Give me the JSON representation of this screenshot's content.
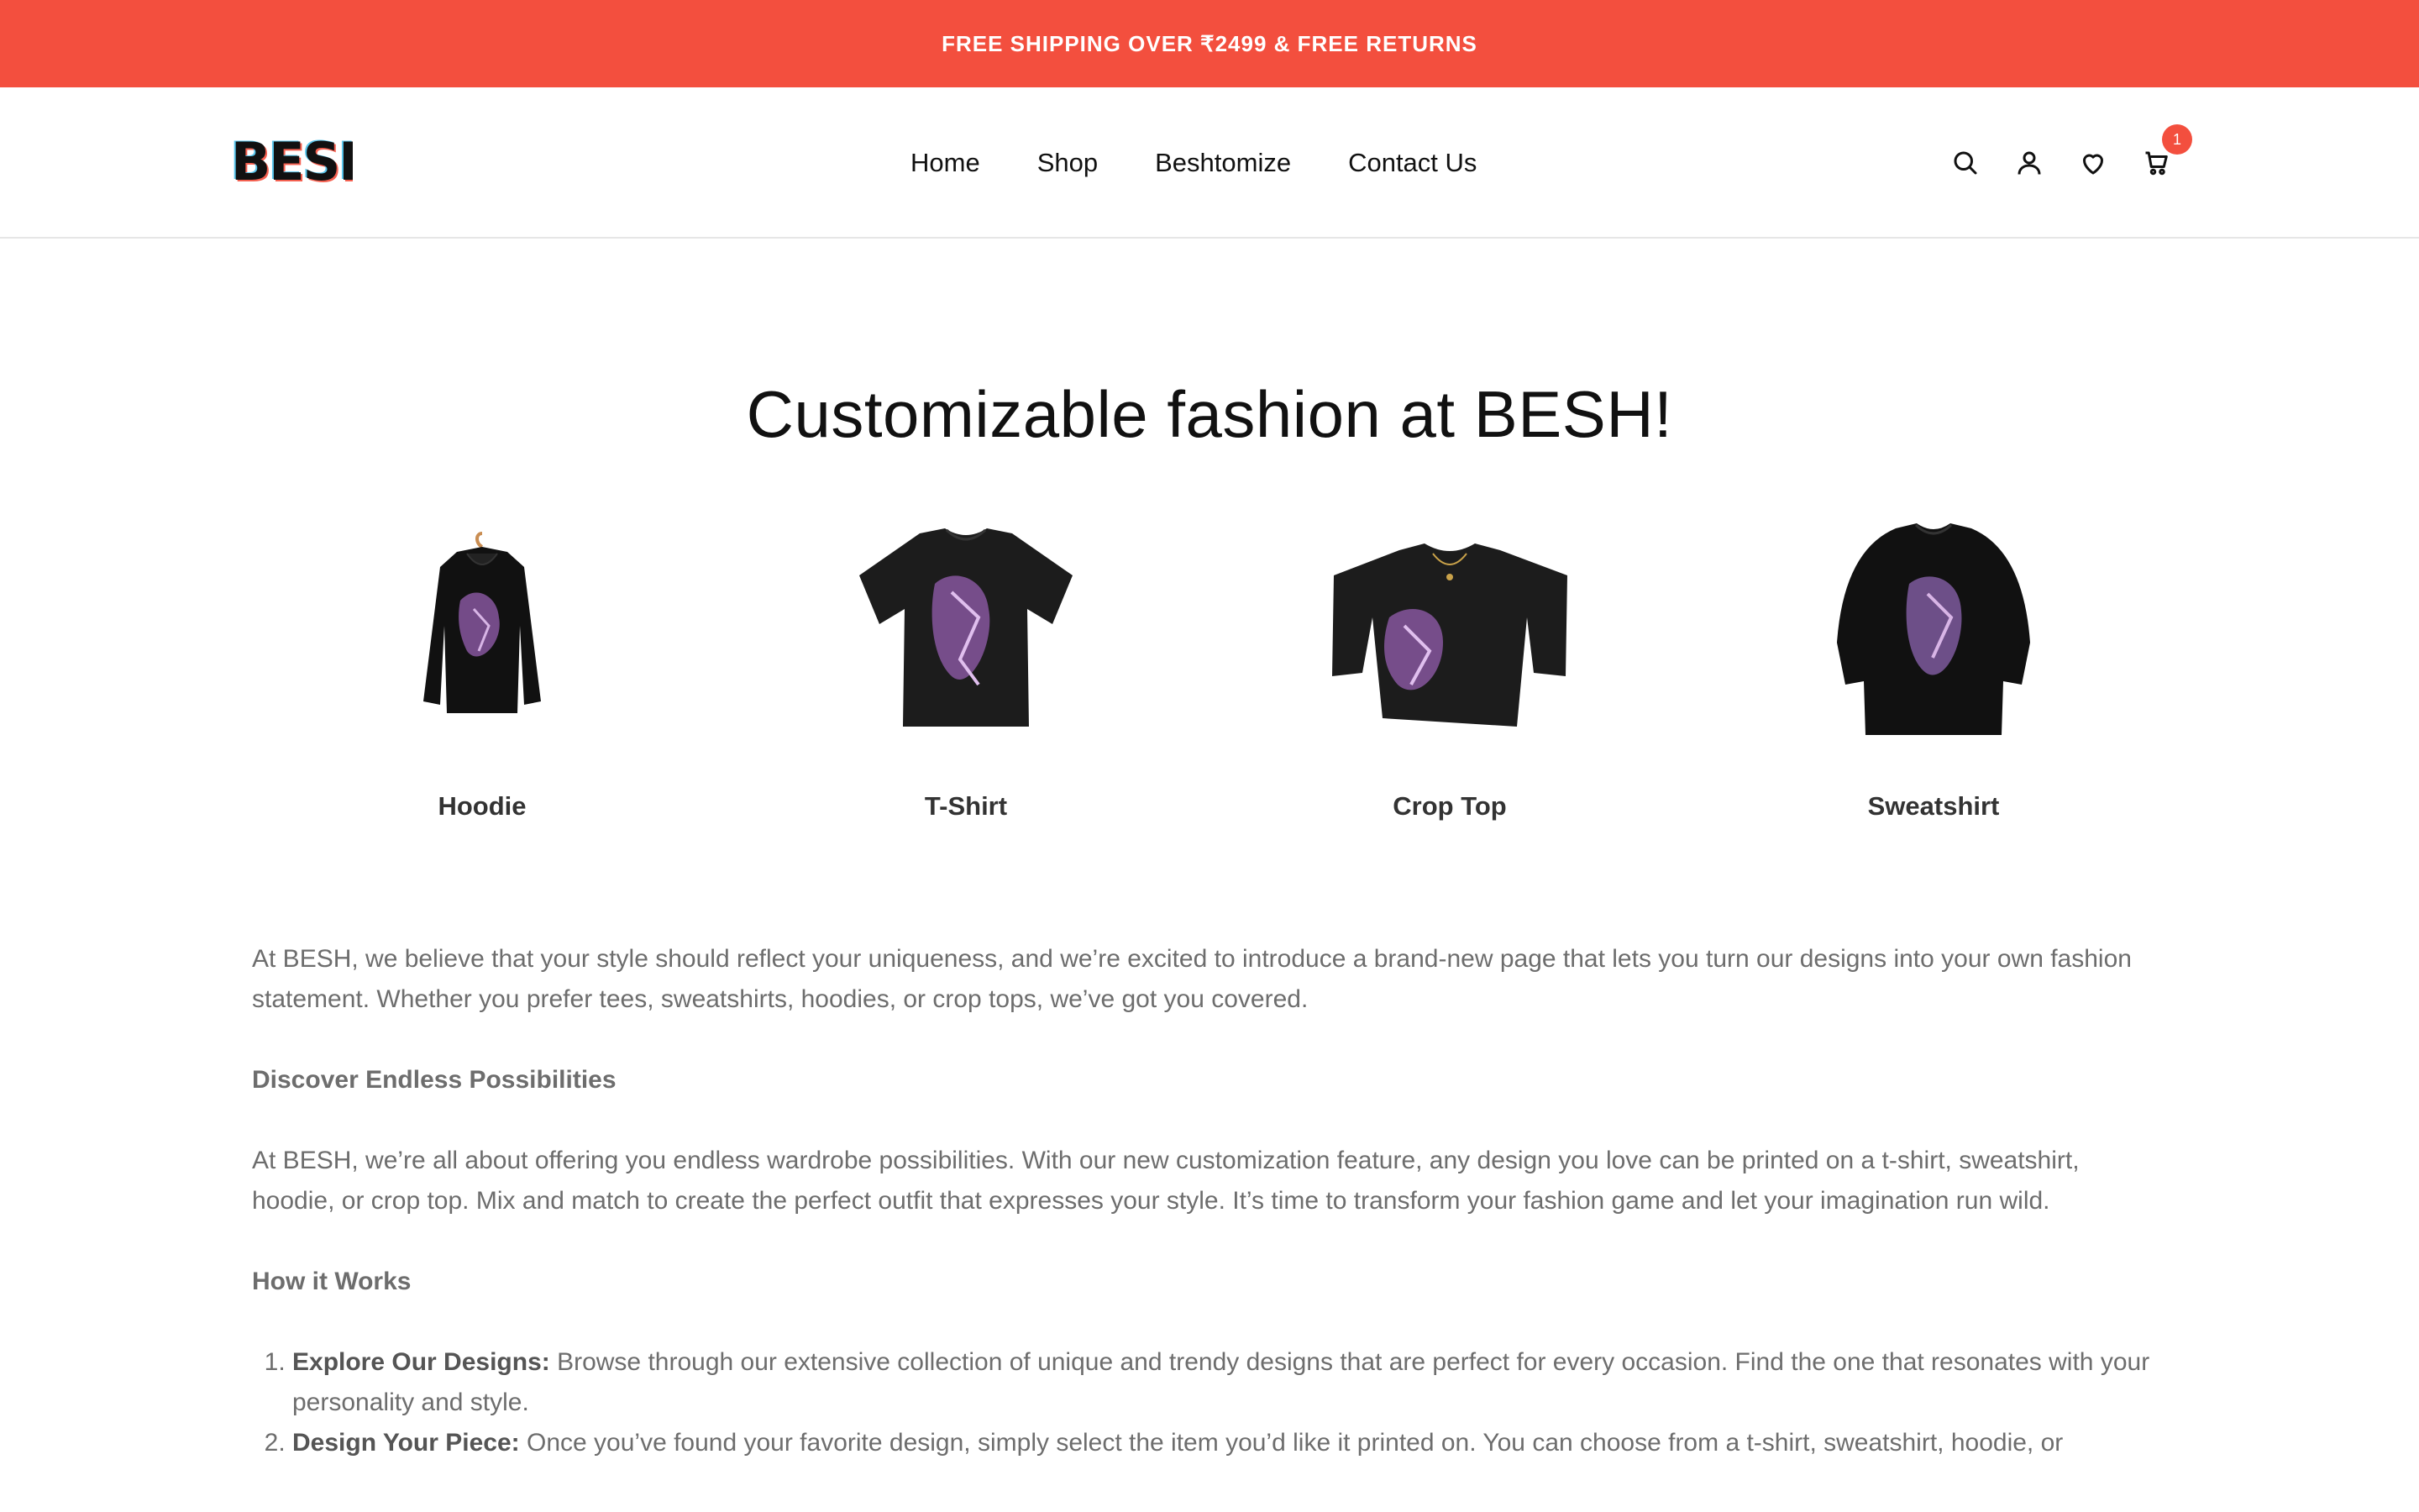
{
  "promo": {
    "text": "FREE SHIPPING OVER ₹2499 & FREE RETURNS",
    "color": "#f34f3e"
  },
  "logo": {
    "text": "BESH"
  },
  "nav": {
    "items": [
      "Home",
      "Shop",
      "Beshtomize",
      "Contact Us"
    ]
  },
  "header_icons": {
    "search": "search-icon",
    "account": "user-icon",
    "wishlist": "heart-icon",
    "cart": "cart-icon",
    "cart_count": "1"
  },
  "page": {
    "title": "Customizable fashion at BESH!"
  },
  "products": [
    {
      "name": "Hoodie"
    },
    {
      "name": "T-Shirt"
    },
    {
      "name": "Crop Top"
    },
    {
      "name": "Sweatshirt"
    }
  ],
  "content": {
    "intro": "At BESH, we believe that your style should reflect your uniqueness, and we’re excited to introduce a brand-new page that lets you turn our designs into your own fashion statement. Whether you prefer tees, sweatshirts, hoodies, or crop tops, we’ve got you covered.",
    "subhead1": "Discover Endless Possibilities",
    "para2": "At BESH, we’re all about offering you endless wardrobe possibilities. With our new customization feature, any design you love can be printed on a t-shirt, sweatshirt, hoodie, or crop top. Mix and match to create the perfect outfit that expresses your style. It’s time to transform your fashion game and let your imagination run wild.",
    "subhead2": "How it Works",
    "steps": [
      {
        "title": "Explore Our Designs:",
        "text": " Browse through our extensive collection of unique and trendy designs that are perfect for every occasion. Find the one that resonates with your personality and style."
      },
      {
        "title": "Design Your Piece:",
        "text": " Once you’ve found your favorite design, simply select the item you’d like it printed on. You can choose from a t-shirt, sweatshirt, hoodie, or"
      }
    ]
  }
}
